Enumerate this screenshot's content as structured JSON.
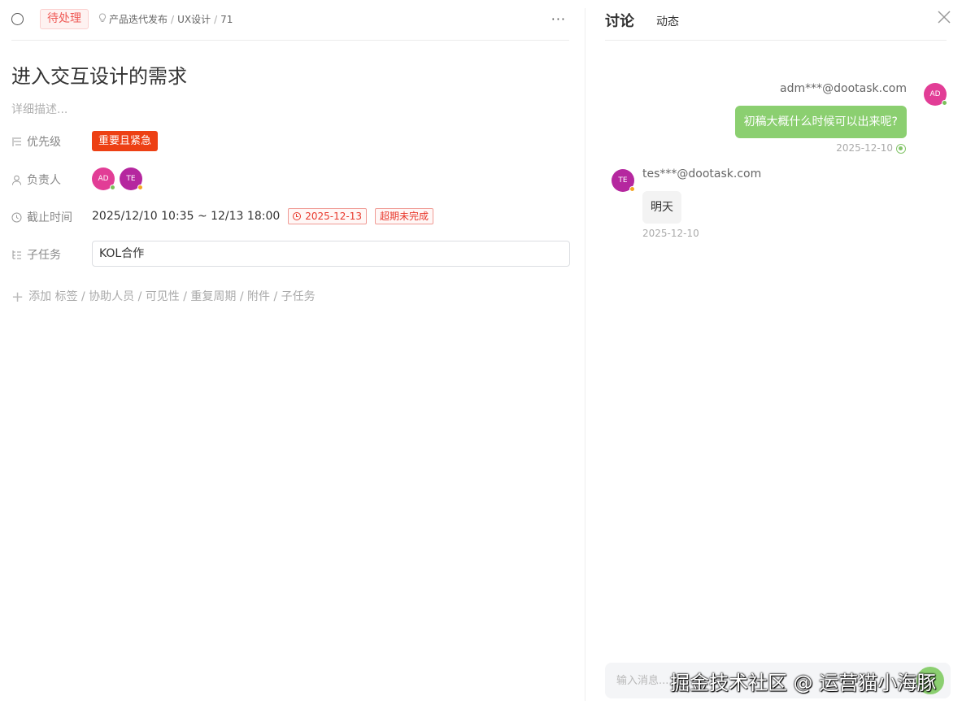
{
  "task": {
    "status_label": "待处理",
    "breadcrumb": {
      "project": "产品迭代发布",
      "column": "UX设计",
      "task_id": "71"
    },
    "more_label": "···",
    "title": "进入交互设计的需求",
    "description_placeholder": "详细描述...",
    "fields": {
      "priority": {
        "label": "优先级",
        "value": "重要且紧急",
        "color": "#ed4014"
      },
      "owner": {
        "label": "负责人",
        "avatars": [
          {
            "initials": "AD",
            "color": "#e23d96",
            "status_color": "#7ac05a"
          },
          {
            "initials": "TE",
            "color": "#b5279f",
            "status_color": "#f5a623"
          }
        ]
      },
      "deadline": {
        "label": "截止时间",
        "range": "2025/12/10 10:35 ~ 12/13 18:00",
        "due_tag": "2025-12-13",
        "overdue_tag": "超期未完成"
      },
      "subtask": {
        "label": "子任务",
        "value": "KOL合作"
      }
    },
    "add_more": "添加 标签 / 协助人员 / 可见性 / 重复周期 / 附件 / 子任务"
  },
  "discussion": {
    "tabs": {
      "discuss": "讨论",
      "activity": "动态"
    },
    "messages": [
      {
        "side": "right",
        "user": "adm***@dootask.com",
        "avatar": "AD",
        "avatar_color": "#e23d96",
        "text": "初稿大概什么时候可以出来呢?",
        "time": "2025-12-10"
      },
      {
        "side": "left",
        "user": "tes***@dootask.com",
        "avatar": "TE",
        "avatar_color": "#b5279f",
        "text": "明天",
        "time": "2025-12-10"
      }
    ],
    "input_placeholder": "输入消息..."
  },
  "watermark": "掘金技术社区 @ 运营猫小海豚",
  "colors": {
    "accent_green": "#8bcf70",
    "danger_red": "#e8372b"
  }
}
